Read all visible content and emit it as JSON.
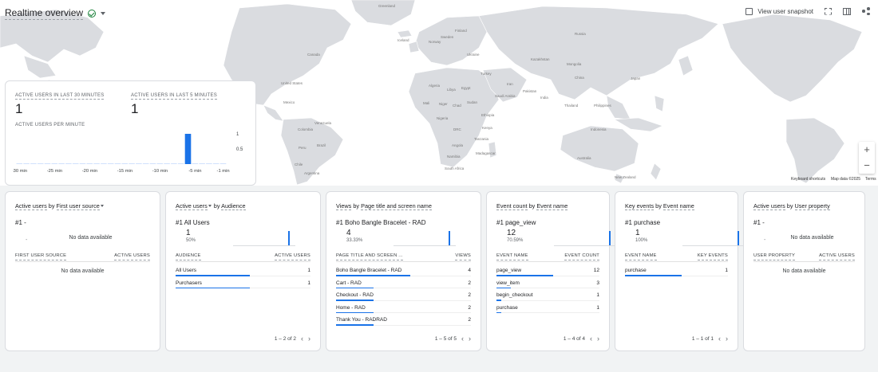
{
  "header": {
    "title": "Realtime overview",
    "actions": {
      "snapshot_label": "View user snapshot"
    }
  },
  "map": {
    "labels": [
      "Greenland",
      "Canada",
      "United States",
      "Mexico",
      "Brazil",
      "Peru",
      "Argentina",
      "Chile",
      "Colombia",
      "Venezuela",
      "Russia",
      "Kazakhstan",
      "China",
      "Mongolia",
      "India",
      "Iran",
      "Turkey",
      "Saudi Arabia",
      "Egypt",
      "Libya",
      "Algeria",
      "Mali",
      "Niger",
      "Chad",
      "Sudan",
      "Ethiopia",
      "Nigeria",
      "DRC",
      "Kenya",
      "Tanzania",
      "Angola",
      "Namibia",
      "South Africa",
      "Madagascar",
      "Australia",
      "Indonesia",
      "Japan",
      "Finland",
      "Sweden",
      "Norway",
      "Pakistan",
      "Thailand",
      "Philippines",
      "New Zealand",
      "Iceland",
      "Ukraine"
    ],
    "footer": {
      "shortcuts": "Keyboard shortcuts",
      "mapdata": "Map data ©2025",
      "terms": "Terms"
    },
    "zoom_in": "+",
    "zoom_out": "−"
  },
  "active_users": {
    "label_30": "ACTIVE USERS IN LAST 30 MINUTES",
    "value_30": "1",
    "label_5": "ACTIVE USERS IN LAST 5 MINUTES",
    "value_5": "1",
    "per_minute_label": "ACTIVE USERS PER MINUTE"
  },
  "chart_data": {
    "type": "bar",
    "title": "ACTIVE USERS PER MINUTE",
    "x_ticks": [
      "-30 min",
      "-25 min",
      "-20 min",
      "-15 min",
      "-10 min",
      "-5 min",
      "-1 min"
    ],
    "y_ticks": [
      "1",
      "0.5"
    ],
    "ylim": [
      0,
      1
    ],
    "minutes": [
      -30,
      -1
    ],
    "values": [
      {
        "minute": -6,
        "value": 1
      }
    ]
  },
  "panels": [
    {
      "title_prefix": "Active users",
      "title_mid": " by ",
      "title_dim": "First user source",
      "dropdown_after_dim": true,
      "top": "#1  -",
      "no_data_top": "No data available",
      "dash": "-",
      "col1": "FIRST USER SOURCE",
      "col2": "ACTIVE USERS",
      "no_data_table": "No data available"
    },
    {
      "title_prefix": "Active users",
      "title_mid": " by ",
      "title_dim": "Audience",
      "dropdown_after_metric": true,
      "top": "#1  All Users",
      "value": "1",
      "pct": "50%",
      "col1": "AUDIENCE",
      "col2": "ACTIVE USERS",
      "rows": [
        {
          "label": "All Users",
          "value": "1",
          "share": 1
        },
        {
          "label": "Purchasers",
          "value": "1",
          "share": 1
        }
      ],
      "pager": "1 – 2 of 2"
    },
    {
      "title_prefix": "Views",
      "title_mid": " by ",
      "title_dim": "Page title and screen name",
      "top": "#1  Boho Bangle Bracelet - RAD",
      "value": "4",
      "pct": "33.33%",
      "col1": "PAGE TITLE AND SCREEN ...",
      "col2": "VIEWS",
      "rows": [
        {
          "label": "Boho Bangle Bracelet - RAD",
          "value": "4",
          "share": 1
        },
        {
          "label": "Cart - RAD",
          "value": "2",
          "share": 0.5
        },
        {
          "label": "Checkout - RAD",
          "value": "2",
          "share": 0.5
        },
        {
          "label": "Home - RAD",
          "value": "2",
          "share": 0.5
        },
        {
          "label": "Thank You - RADRAD",
          "value": "2",
          "share": 0.5
        }
      ],
      "pager": "1 – 5 of 5"
    },
    {
      "title_prefix": "Event count",
      "title_mid": " by ",
      "title_dim": "Event name",
      "top": "#1  page_view",
      "value": "12",
      "pct": "70.59%",
      "col1": "EVENT NAME",
      "col2": "EVENT COUNT",
      "rows": [
        {
          "label": "page_view",
          "value": "12",
          "share": 1
        },
        {
          "label": "view_item",
          "value": "3",
          "share": 0.25
        },
        {
          "label": "begin_checkout",
          "value": "1",
          "share": 0.083
        },
        {
          "label": "purchase",
          "value": "1",
          "share": 0.083
        }
      ],
      "pager": "1 – 4 of 4"
    },
    {
      "title_prefix": "Key events",
      "title_mid": " by ",
      "title_dim": "Event name",
      "top": "#1  purchase",
      "value": "1",
      "pct": "100%",
      "col1": "EVENT NAME",
      "col2": "KEY EVENTS",
      "rows": [
        {
          "label": "purchase",
          "value": "1",
          "share": 1
        }
      ],
      "pager": "1 – 1 of 1"
    },
    {
      "title_prefix": "Active users",
      "title_mid": " by ",
      "title_dim": "User property",
      "top": "#1  -",
      "no_data_top": "No data available",
      "dash": "-",
      "col1": "USER PROPERTY",
      "col2": "ACTIVE USERS",
      "no_data_table": "No data available"
    }
  ],
  "pager_prev": "‹",
  "pager_next": "›",
  "colors": {
    "accent": "#1a73e8",
    "land": "#dadce0",
    "ok": "#188038"
  }
}
